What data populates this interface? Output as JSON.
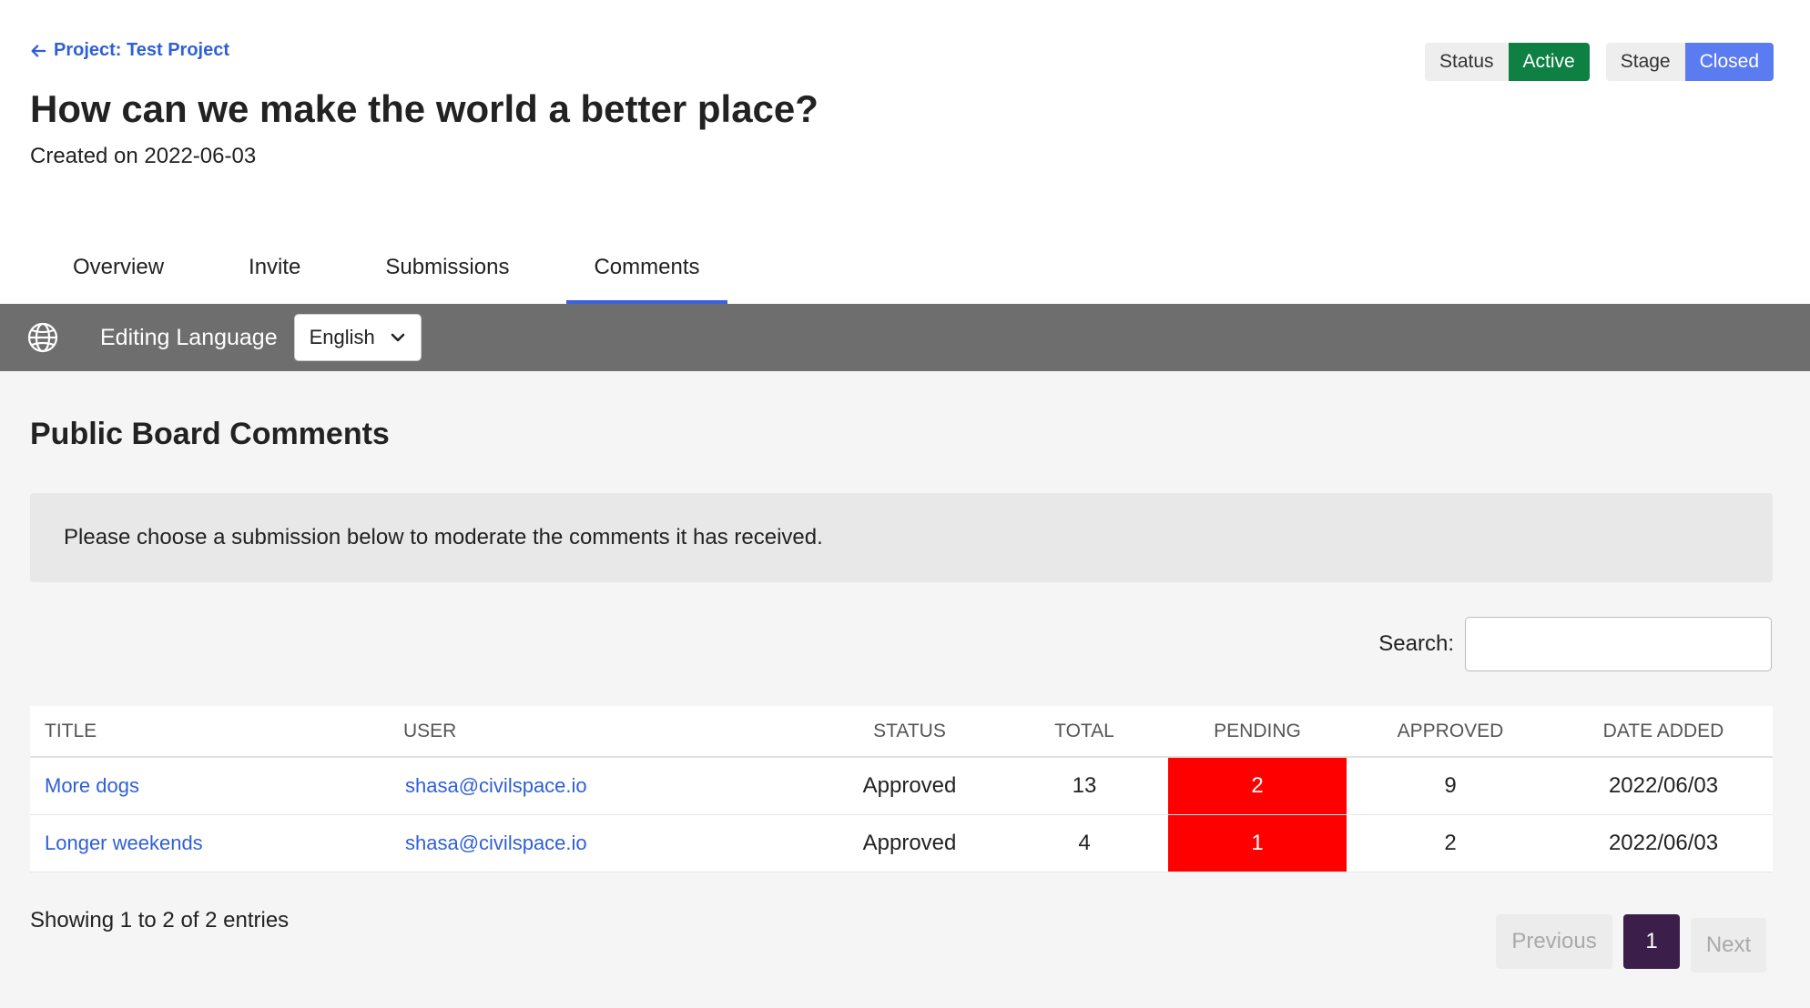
{
  "header": {
    "back_link": "Project: Test Project",
    "title": "How can we make the world a better place?",
    "created": "Created on 2022-06-03",
    "status_label": "Status",
    "status_value": "Active",
    "stage_label": "Stage",
    "stage_value": "Closed"
  },
  "tabs": [
    {
      "label": "Overview"
    },
    {
      "label": "Invite"
    },
    {
      "label": "Submissions"
    },
    {
      "label": "Comments",
      "active": true
    }
  ],
  "language_bar": {
    "icon": "globe-icon",
    "label": "Editing Language",
    "selected": "English"
  },
  "main": {
    "section_title": "Public Board Comments",
    "info_text": "Please choose a submission below to moderate the comments it has received.",
    "search_label": "Search:",
    "search_value": "",
    "table": {
      "columns": [
        "TITLE",
        "USER",
        "STATUS",
        "TOTAL",
        "PENDING",
        "APPROVED",
        "DATE ADDED"
      ],
      "rows": [
        {
          "title": "More dogs",
          "user": "shasa@civilspace.io",
          "status": "Approved",
          "total": "13",
          "pending": "2",
          "approved": "9",
          "date": "2022/06/03"
        },
        {
          "title": "Longer weekends",
          "user": "shasa@civilspace.io",
          "status": "Approved",
          "total": "4",
          "pending": "1",
          "approved": "2",
          "date": "2022/06/03"
        }
      ]
    },
    "showing": "Showing 1 to 2 of 2 entries",
    "pagination": {
      "previous": "Previous",
      "page": "1",
      "next": "Next"
    }
  },
  "colors": {
    "link": "#2f5fd8",
    "status_active": "#0e8043",
    "stage_closed": "#5b7cf0",
    "tab_underline": "#3a62e0",
    "language_bar": "#6e6e6e",
    "pending_highlight": "#ff0000",
    "pagination_current": "#3b1f4a"
  }
}
